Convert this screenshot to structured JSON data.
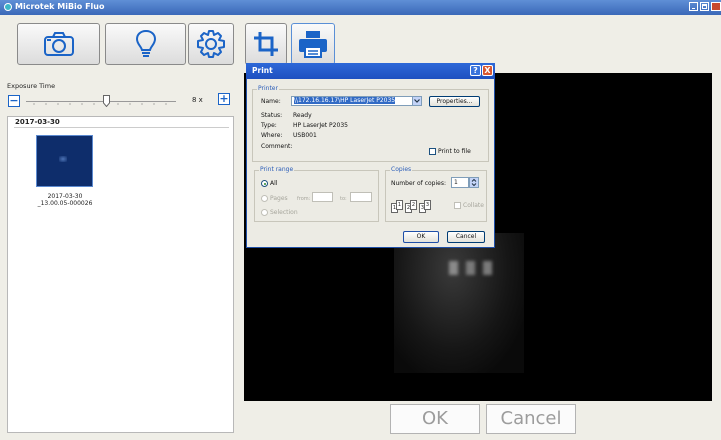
{
  "app": {
    "title": "Microtek MiBio Fluo"
  },
  "colors": {
    "accent": "#1b64c7",
    "dialog_title": "#1e50c0",
    "viewer_bg": "#000000"
  },
  "toolbar": {
    "buttons": [
      {
        "icon": "camera-icon"
      },
      {
        "icon": "lightbulb-icon"
      },
      {
        "icon": "gear-icon"
      },
      {
        "icon": "crop-icon"
      },
      {
        "icon": "printer-icon"
      }
    ]
  },
  "exposure": {
    "label": "Exposure Time",
    "value_text": "8 x",
    "minus_label": "−",
    "plus_label": "+",
    "level_fraction": 0.52
  },
  "gallery": {
    "date_header": "2017-03-30",
    "items": [
      {
        "caption_line1": "2017-03-30",
        "caption_line2": "_13.00.05-000026"
      }
    ]
  },
  "viewer": {
    "ok_label": "OK",
    "cancel_label": "Cancel"
  },
  "print_dialog": {
    "title": "Print",
    "help_label": "?",
    "close_label": "X",
    "printer_group": "Printer",
    "name_label": "Name:",
    "printer_name": "\\\\172.16.16.17\\HP LaserJet P2035",
    "properties_label": "Properties...",
    "status_label": "Status:",
    "status_value": "Ready",
    "type_label": "Type:",
    "type_value": "HP LaserJet P2035",
    "where_label": "Where:",
    "where_value": "USB001",
    "comment_label": "Comment:",
    "print_to_file_label": "Print to file",
    "range_group": "Print range",
    "all_label": "All",
    "pages_label": "Pages",
    "from_label": "from:",
    "to_label": "to:",
    "selection_label": "Selection",
    "copies_group": "Copies",
    "copies_label": "Number of copies:",
    "copies_value": "1",
    "collate_label": "Collate",
    "collate_pages": [
      "1",
      "1",
      "2",
      "2",
      "3",
      "3"
    ],
    "ok_label": "OK",
    "cancel_label": "Cancel"
  }
}
